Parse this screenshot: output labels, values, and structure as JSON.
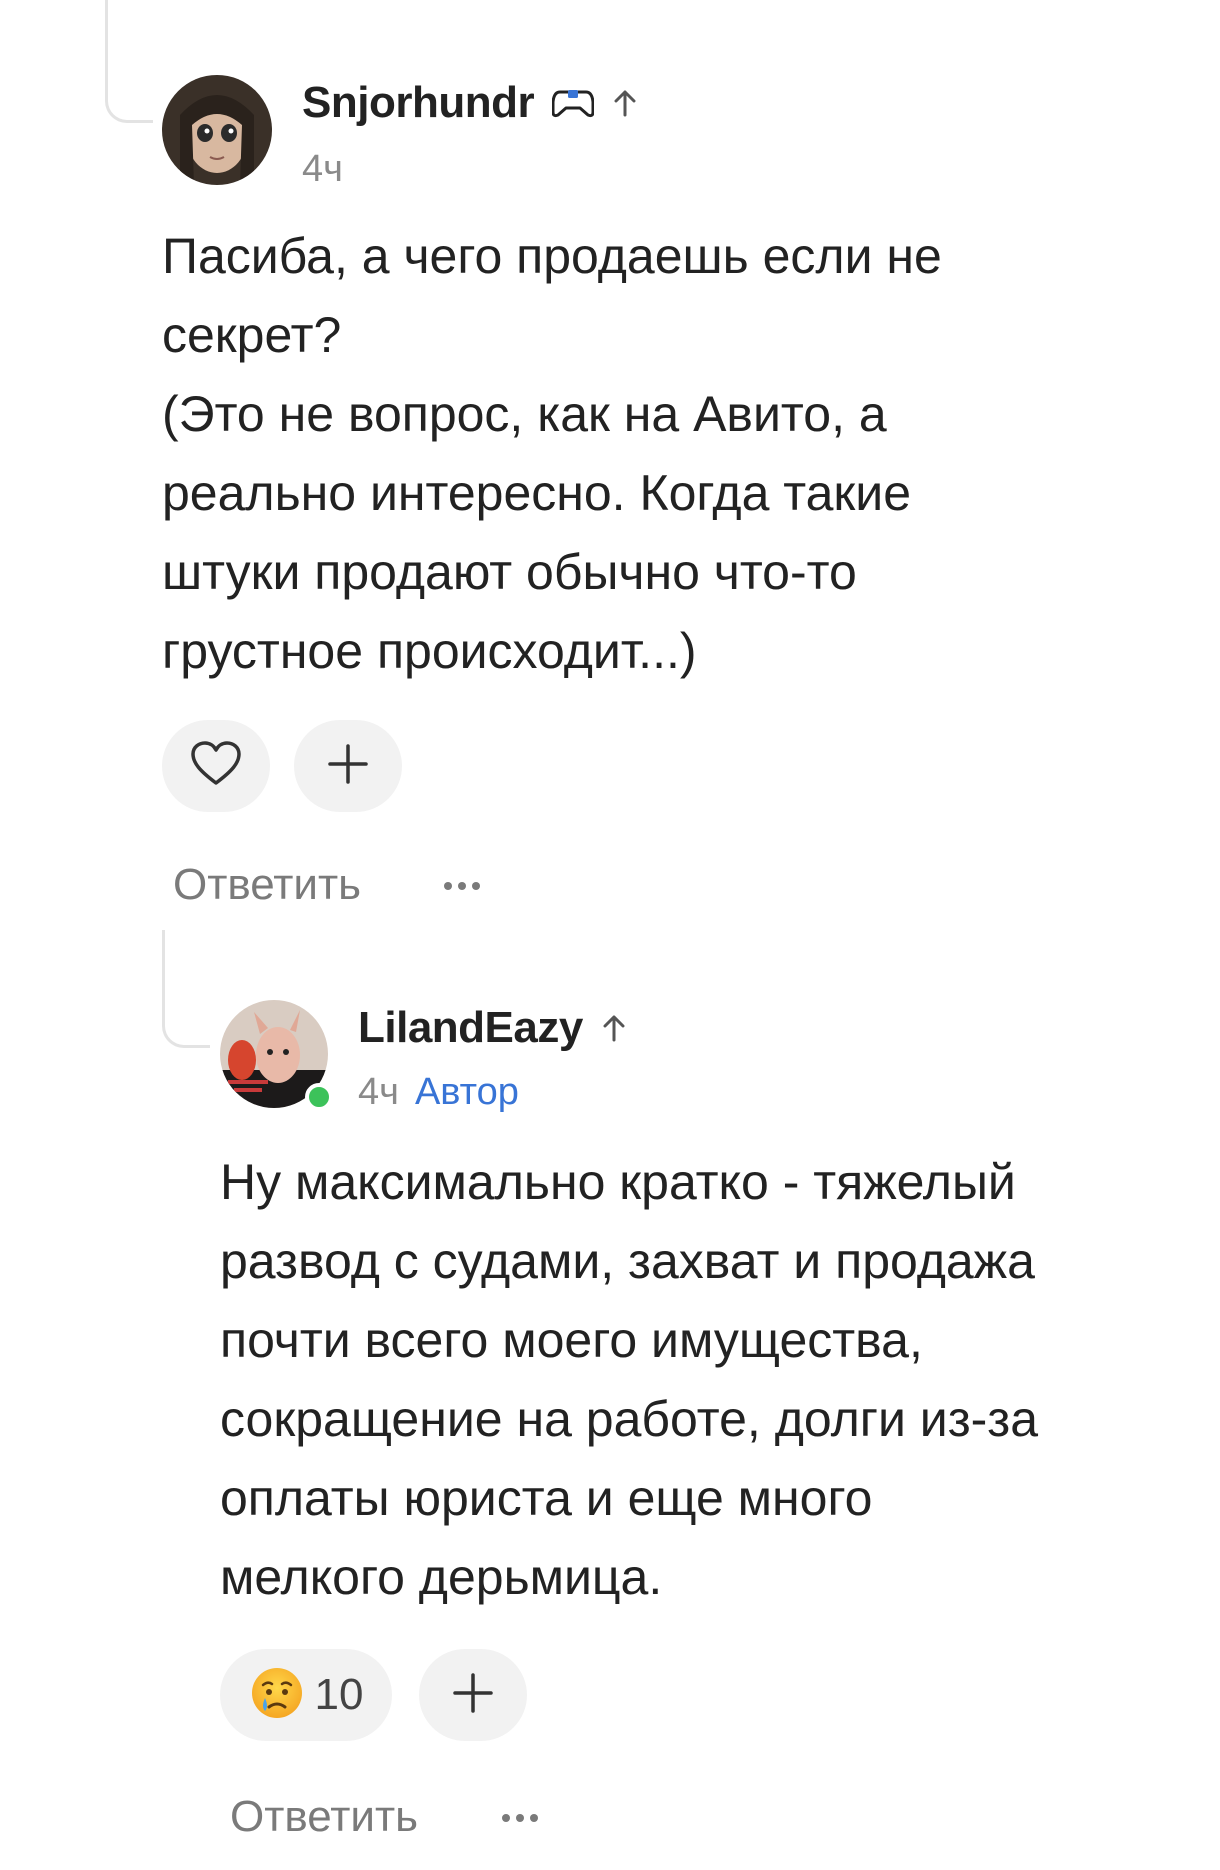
{
  "comments": [
    {
      "author": "Snjorhundr",
      "author_badge_icon": "gamepad-icon",
      "time": "4ч",
      "text": "Пасиба, а чего продаешь если не\nсекрет?\n(Это не вопрос, как на Авито, а\nреально интересно. Когда такие\nштуки продают обычно что-то\nгрустное происходит...)",
      "reaction": {
        "icon": "heart-icon",
        "count": ""
      },
      "reply_label": "Ответить"
    },
    {
      "author": "LilandEazy",
      "time": "4ч",
      "badge": "Автор",
      "online": true,
      "text": "Ну максимально кратко - тяжелый\nразвод с судами, захват и продажа\nпочти всего моего имущества,\nсокращение на работе, долги из-за\nоплаты юриста и еще много\nмелкого дерьмица.",
      "reaction": {
        "icon": "crying-face-emoji",
        "count": "10"
      },
      "reply_label": "Ответить"
    }
  ],
  "colors": {
    "author_badge": "#3874d6",
    "online": "#3cc25a",
    "pill_bg": "#f2f2f2"
  }
}
